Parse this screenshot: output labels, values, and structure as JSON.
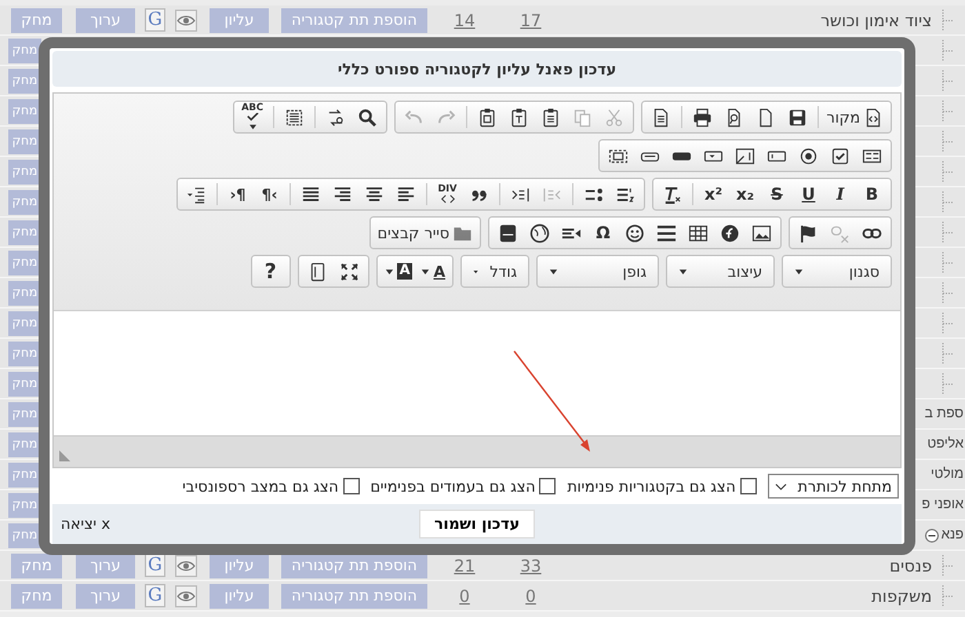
{
  "background_rows": [
    {
      "kind": "full",
      "name": "ציוד אימון וכושר",
      "count_1": "17",
      "count_2": "14",
      "add_label": "הוספת תת קטגוריה",
      "top_label": "עליון",
      "g_label": "G",
      "edit_label": "ערוך",
      "delete_label": "מחק"
    },
    {
      "kind": "covered",
      "delete_label": "מחק"
    },
    {
      "kind": "covered",
      "delete_label": "מחק"
    },
    {
      "kind": "covered",
      "delete_label": "מחק"
    },
    {
      "kind": "covered",
      "delete_label": "מחק"
    },
    {
      "kind": "covered",
      "delete_label": "מחק"
    },
    {
      "kind": "covered",
      "delete_label": "מחק"
    },
    {
      "kind": "covered",
      "delete_label": "מחק"
    },
    {
      "kind": "covered",
      "delete_label": "מחק"
    },
    {
      "kind": "covered",
      "delete_label": "מחק"
    },
    {
      "kind": "covered",
      "delete_label": "מחק"
    },
    {
      "kind": "covered",
      "delete_label": "מחק"
    },
    {
      "kind": "covered",
      "delete_label": "מחק"
    },
    {
      "kind": "covered",
      "name": "ספת ב",
      "delete_label": "מחק"
    },
    {
      "kind": "covered",
      "name": "אליפט",
      "delete_label": "מחק"
    },
    {
      "kind": "covered",
      "name": "מולטי",
      "delete_label": "מחק"
    },
    {
      "kind": "covered",
      "name": "אופני פ",
      "delete_label": "מחק"
    },
    {
      "kind": "covered",
      "name": "פנא",
      "expanded": true,
      "delete_label": "מחק"
    },
    {
      "kind": "full",
      "name": "פנסים",
      "count_1": "33",
      "count_2": "21",
      "add_label": "הוספת תת קטגוריה",
      "top_label": "עליון",
      "g_label": "G",
      "edit_label": "ערוך",
      "delete_label": "מחק"
    },
    {
      "kind": "full",
      "name": "משקפות",
      "count_1": "0",
      "count_2": "0",
      "add_label": "הוספת תת קטגוריה",
      "top_label": "עליון",
      "g_label": "G",
      "edit_label": "ערוך",
      "delete_label": "מחק"
    }
  ],
  "dialog": {
    "title": "עדכון פאנל עליון לקטגוריה ספורט כללי",
    "toolbar": [
      [
        [
          [
            {
              "kind": "source",
              "label": "מקור"
            }
          ],
          [
            {
              "kind": "save"
            },
            {
              "kind": "newpage"
            },
            {
              "kind": "preview"
            },
            {
              "kind": "print"
            }
          ],
          [
            {
              "kind": "templates"
            }
          ]
        ],
        [
          [
            {
              "kind": "cut",
              "disabled": true
            },
            {
              "kind": "copy",
              "disabled": true
            },
            {
              "kind": "paste"
            },
            {
              "kind": "pastetext"
            },
            {
              "kind": "pasteword"
            }
          ],
          [
            {
              "kind": "redo",
              "disabled": true
            },
            {
              "kind": "undo",
              "disabled": true
            }
          ]
        ],
        [
          [
            {
              "kind": "find"
            },
            {
              "kind": "replace"
            }
          ],
          [
            {
              "kind": "selectall"
            }
          ],
          [
            {
              "kind": "spellcheck",
              "label": "ABC"
            }
          ]
        ]
      ],
      [
        [
          [
            {
              "kind": "form"
            },
            {
              "kind": "checkbox"
            },
            {
              "kind": "radio"
            },
            {
              "kind": "textfield"
            },
            {
              "kind": "textarea"
            },
            {
              "kind": "select"
            },
            {
              "kind": "button"
            },
            {
              "kind": "imagebutton"
            },
            {
              "kind": "hidden"
            }
          ]
        ]
      ],
      [
        [
          [
            {
              "kind": "bold",
              "label": "B"
            },
            {
              "kind": "italic",
              "label": "I"
            },
            {
              "kind": "underline",
              "label": "U"
            },
            {
              "kind": "strike",
              "label": "S"
            },
            {
              "kind": "subscript",
              "label": "x₂"
            },
            {
              "kind": "superscript",
              "label": "x²"
            }
          ],
          [
            {
              "kind": "removeformat"
            }
          ]
        ],
        [
          [
            {
              "kind": "numlist"
            },
            {
              "kind": "bullist"
            }
          ],
          [
            {
              "kind": "outdent",
              "disabled": true
            },
            {
              "kind": "indent"
            }
          ],
          [
            {
              "kind": "blockquote"
            },
            {
              "kind": "creatediv",
              "label": "DIV"
            }
          ],
          [
            {
              "kind": "alignleft"
            },
            {
              "kind": "aligncenter"
            },
            {
              "kind": "alignright"
            },
            {
              "kind": "justify"
            }
          ],
          [
            {
              "kind": "ltr",
              "label": "›¶"
            },
            {
              "kind": "rtl",
              "label": "¶‹"
            }
          ],
          [
            {
              "kind": "language"
            }
          ]
        ]
      ],
      [
        [
          [
            {
              "kind": "link"
            },
            {
              "kind": "unlink",
              "disabled": true
            },
            {
              "kind": "anchor"
            }
          ]
        ],
        [
          [
            {
              "kind": "image"
            },
            {
              "kind": "flash"
            },
            {
              "kind": "table"
            },
            {
              "kind": "hr"
            },
            {
              "kind": "smiley"
            },
            {
              "kind": "specialchar",
              "label": "Ω"
            },
            {
              "kind": "video"
            },
            {
              "kind": "iframe"
            },
            {
              "kind": "youtube"
            }
          ]
        ],
        [
          [
            {
              "kind": "filebrowser",
              "label": "סייר קבצים"
            }
          ]
        ]
      ],
      [
        [
          [
            {
              "kind": "combo",
              "label": "סגנון"
            }
          ]
        ],
        [
          [
            {
              "kind": "combo",
              "label": "עיצוב"
            }
          ]
        ],
        [
          [
            {
              "kind": "combo",
              "label": "גופן"
            }
          ]
        ],
        [
          [
            {
              "kind": "combo",
              "label": "גודל"
            }
          ]
        ],
        [
          [
            {
              "kind": "textcolor",
              "label": "A"
            },
            {
              "kind": "bgcolor",
              "label": "A"
            }
          ]
        ],
        [
          [
            {
              "kind": "maximize"
            },
            {
              "kind": "showblocks"
            }
          ]
        ],
        [
          [
            {
              "kind": "about",
              "label": "?"
            }
          ]
        ]
      ]
    ],
    "position_select": {
      "value": "מתחת לכותרת"
    },
    "options": [
      {
        "label": "הצג גם בקטגוריות פנימיות",
        "checked": false
      },
      {
        "label": "הצג גם בעמודים בפנימיים",
        "checked": false
      },
      {
        "label": "הצג גם במצב רספונסיבי",
        "checked": false
      }
    ],
    "save_button": "עדכון ושמור",
    "exit_link": "x יציאה"
  }
}
